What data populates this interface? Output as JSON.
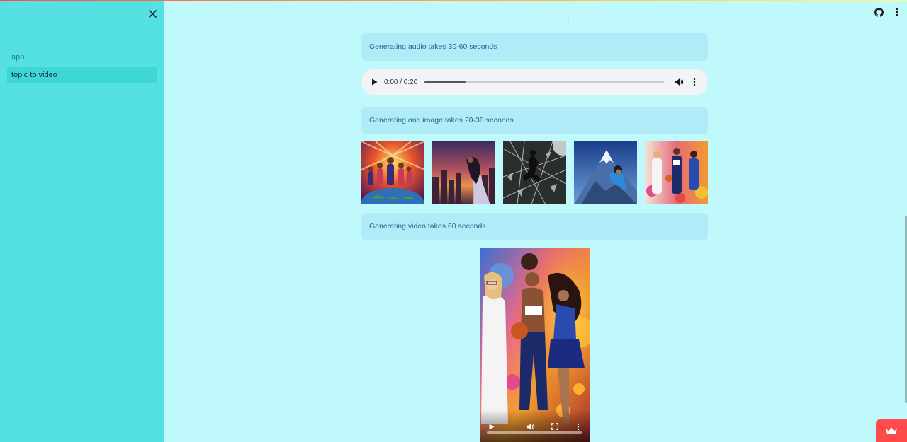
{
  "sidebar": {
    "close_icon": "close-icon",
    "items": [
      {
        "label": "app",
        "active": false
      },
      {
        "label": "topic to video",
        "active": true
      }
    ]
  },
  "header": {
    "github_icon": "github-icon",
    "menu_icon": "more-vertical-icon"
  },
  "main": {
    "audio_info": "Generating audio takes 30-60 seconds",
    "audio_player": {
      "time": "0:00 / 0:20",
      "progress": 0.17
    },
    "image_info": "Generating one image takes 20-30 seconds",
    "images": [
      {
        "name": "heroines-on-globe"
      },
      {
        "name": "girl-over-city-sunset"
      },
      {
        "name": "girl-breaking-glass"
      },
      {
        "name": "girl-climbing-mountain"
      },
      {
        "name": "three-girls-colorful"
      }
    ],
    "video_info": "Generating video takes 60 seconds",
    "video_player": {
      "progress": 0
    }
  },
  "colors": {
    "background": "#bff9fb",
    "sidebar": "#55e1e1",
    "info_box": "#afecf8",
    "info_text": "#1d6a88",
    "accent": "#ff4b4b"
  },
  "badge_icon": "crown-icon"
}
